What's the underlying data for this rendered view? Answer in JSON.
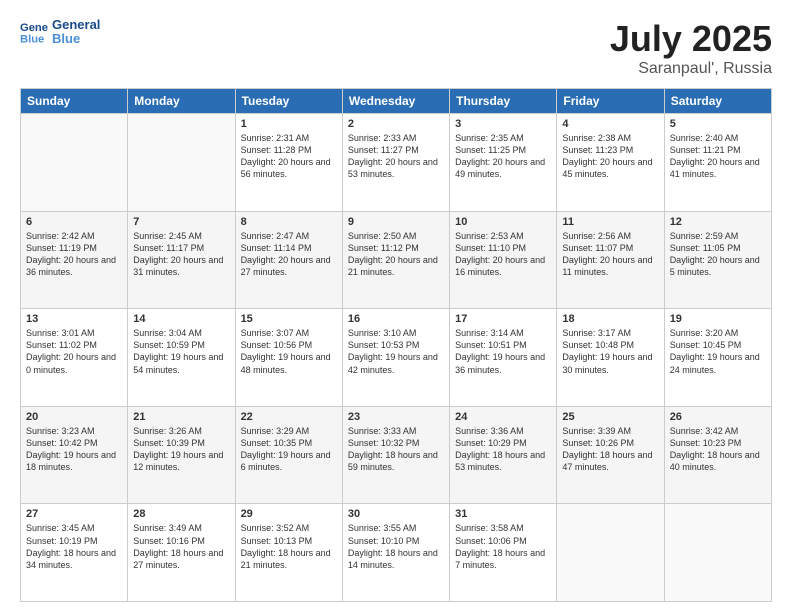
{
  "header": {
    "logo_line1": "General",
    "logo_line2": "Blue",
    "title": "July 2025",
    "subtitle": "Saranpaul', Russia"
  },
  "days": [
    "Sunday",
    "Monday",
    "Tuesday",
    "Wednesday",
    "Thursday",
    "Friday",
    "Saturday"
  ],
  "weeks": [
    [
      {
        "day": "",
        "sunrise": "",
        "sunset": "",
        "daylight": ""
      },
      {
        "day": "",
        "sunrise": "",
        "sunset": "",
        "daylight": ""
      },
      {
        "day": "1",
        "sunrise": "Sunrise: 2:31 AM",
        "sunset": "Sunset: 11:28 PM",
        "daylight": "Daylight: 20 hours and 56 minutes."
      },
      {
        "day": "2",
        "sunrise": "Sunrise: 2:33 AM",
        "sunset": "Sunset: 11:27 PM",
        "daylight": "Daylight: 20 hours and 53 minutes."
      },
      {
        "day": "3",
        "sunrise": "Sunrise: 2:35 AM",
        "sunset": "Sunset: 11:25 PM",
        "daylight": "Daylight: 20 hours and 49 minutes."
      },
      {
        "day": "4",
        "sunrise": "Sunrise: 2:38 AM",
        "sunset": "Sunset: 11:23 PM",
        "daylight": "Daylight: 20 hours and 45 minutes."
      },
      {
        "day": "5",
        "sunrise": "Sunrise: 2:40 AM",
        "sunset": "Sunset: 11:21 PM",
        "daylight": "Daylight: 20 hours and 41 minutes."
      }
    ],
    [
      {
        "day": "6",
        "sunrise": "Sunrise: 2:42 AM",
        "sunset": "Sunset: 11:19 PM",
        "daylight": "Daylight: 20 hours and 36 minutes."
      },
      {
        "day": "7",
        "sunrise": "Sunrise: 2:45 AM",
        "sunset": "Sunset: 11:17 PM",
        "daylight": "Daylight: 20 hours and 31 minutes."
      },
      {
        "day": "8",
        "sunrise": "Sunrise: 2:47 AM",
        "sunset": "Sunset: 11:14 PM",
        "daylight": "Daylight: 20 hours and 27 minutes."
      },
      {
        "day": "9",
        "sunrise": "Sunrise: 2:50 AM",
        "sunset": "Sunset: 11:12 PM",
        "daylight": "Daylight: 20 hours and 21 minutes."
      },
      {
        "day": "10",
        "sunrise": "Sunrise: 2:53 AM",
        "sunset": "Sunset: 11:10 PM",
        "daylight": "Daylight: 20 hours and 16 minutes."
      },
      {
        "day": "11",
        "sunrise": "Sunrise: 2:56 AM",
        "sunset": "Sunset: 11:07 PM",
        "daylight": "Daylight: 20 hours and 11 minutes."
      },
      {
        "day": "12",
        "sunrise": "Sunrise: 2:59 AM",
        "sunset": "Sunset: 11:05 PM",
        "daylight": "Daylight: 20 hours and 5 minutes."
      }
    ],
    [
      {
        "day": "13",
        "sunrise": "Sunrise: 3:01 AM",
        "sunset": "Sunset: 11:02 PM",
        "daylight": "Daylight: 20 hours and 0 minutes."
      },
      {
        "day": "14",
        "sunrise": "Sunrise: 3:04 AM",
        "sunset": "Sunset: 10:59 PM",
        "daylight": "Daylight: 19 hours and 54 minutes."
      },
      {
        "day": "15",
        "sunrise": "Sunrise: 3:07 AM",
        "sunset": "Sunset: 10:56 PM",
        "daylight": "Daylight: 19 hours and 48 minutes."
      },
      {
        "day": "16",
        "sunrise": "Sunrise: 3:10 AM",
        "sunset": "Sunset: 10:53 PM",
        "daylight": "Daylight: 19 hours and 42 minutes."
      },
      {
        "day": "17",
        "sunrise": "Sunrise: 3:14 AM",
        "sunset": "Sunset: 10:51 PM",
        "daylight": "Daylight: 19 hours and 36 minutes."
      },
      {
        "day": "18",
        "sunrise": "Sunrise: 3:17 AM",
        "sunset": "Sunset: 10:48 PM",
        "daylight": "Daylight: 19 hours and 30 minutes."
      },
      {
        "day": "19",
        "sunrise": "Sunrise: 3:20 AM",
        "sunset": "Sunset: 10:45 PM",
        "daylight": "Daylight: 19 hours and 24 minutes."
      }
    ],
    [
      {
        "day": "20",
        "sunrise": "Sunrise: 3:23 AM",
        "sunset": "Sunset: 10:42 PM",
        "daylight": "Daylight: 19 hours and 18 minutes."
      },
      {
        "day": "21",
        "sunrise": "Sunrise: 3:26 AM",
        "sunset": "Sunset: 10:39 PM",
        "daylight": "Daylight: 19 hours and 12 minutes."
      },
      {
        "day": "22",
        "sunrise": "Sunrise: 3:29 AM",
        "sunset": "Sunset: 10:35 PM",
        "daylight": "Daylight: 19 hours and 6 minutes."
      },
      {
        "day": "23",
        "sunrise": "Sunrise: 3:33 AM",
        "sunset": "Sunset: 10:32 PM",
        "daylight": "Daylight: 18 hours and 59 minutes."
      },
      {
        "day": "24",
        "sunrise": "Sunrise: 3:36 AM",
        "sunset": "Sunset: 10:29 PM",
        "daylight": "Daylight: 18 hours and 53 minutes."
      },
      {
        "day": "25",
        "sunrise": "Sunrise: 3:39 AM",
        "sunset": "Sunset: 10:26 PM",
        "daylight": "Daylight: 18 hours and 47 minutes."
      },
      {
        "day": "26",
        "sunrise": "Sunrise: 3:42 AM",
        "sunset": "Sunset: 10:23 PM",
        "daylight": "Daylight: 18 hours and 40 minutes."
      }
    ],
    [
      {
        "day": "27",
        "sunrise": "Sunrise: 3:45 AM",
        "sunset": "Sunset: 10:19 PM",
        "daylight": "Daylight: 18 hours and 34 minutes."
      },
      {
        "day": "28",
        "sunrise": "Sunrise: 3:49 AM",
        "sunset": "Sunset: 10:16 PM",
        "daylight": "Daylight: 18 hours and 27 minutes."
      },
      {
        "day": "29",
        "sunrise": "Sunrise: 3:52 AM",
        "sunset": "Sunset: 10:13 PM",
        "daylight": "Daylight: 18 hours and 21 minutes."
      },
      {
        "day": "30",
        "sunrise": "Sunrise: 3:55 AM",
        "sunset": "Sunset: 10:10 PM",
        "daylight": "Daylight: 18 hours and 14 minutes."
      },
      {
        "day": "31",
        "sunrise": "Sunrise: 3:58 AM",
        "sunset": "Sunset: 10:06 PM",
        "daylight": "Daylight: 18 hours and 7 minutes."
      },
      {
        "day": "",
        "sunrise": "",
        "sunset": "",
        "daylight": ""
      },
      {
        "day": "",
        "sunrise": "",
        "sunset": "",
        "daylight": ""
      }
    ]
  ]
}
